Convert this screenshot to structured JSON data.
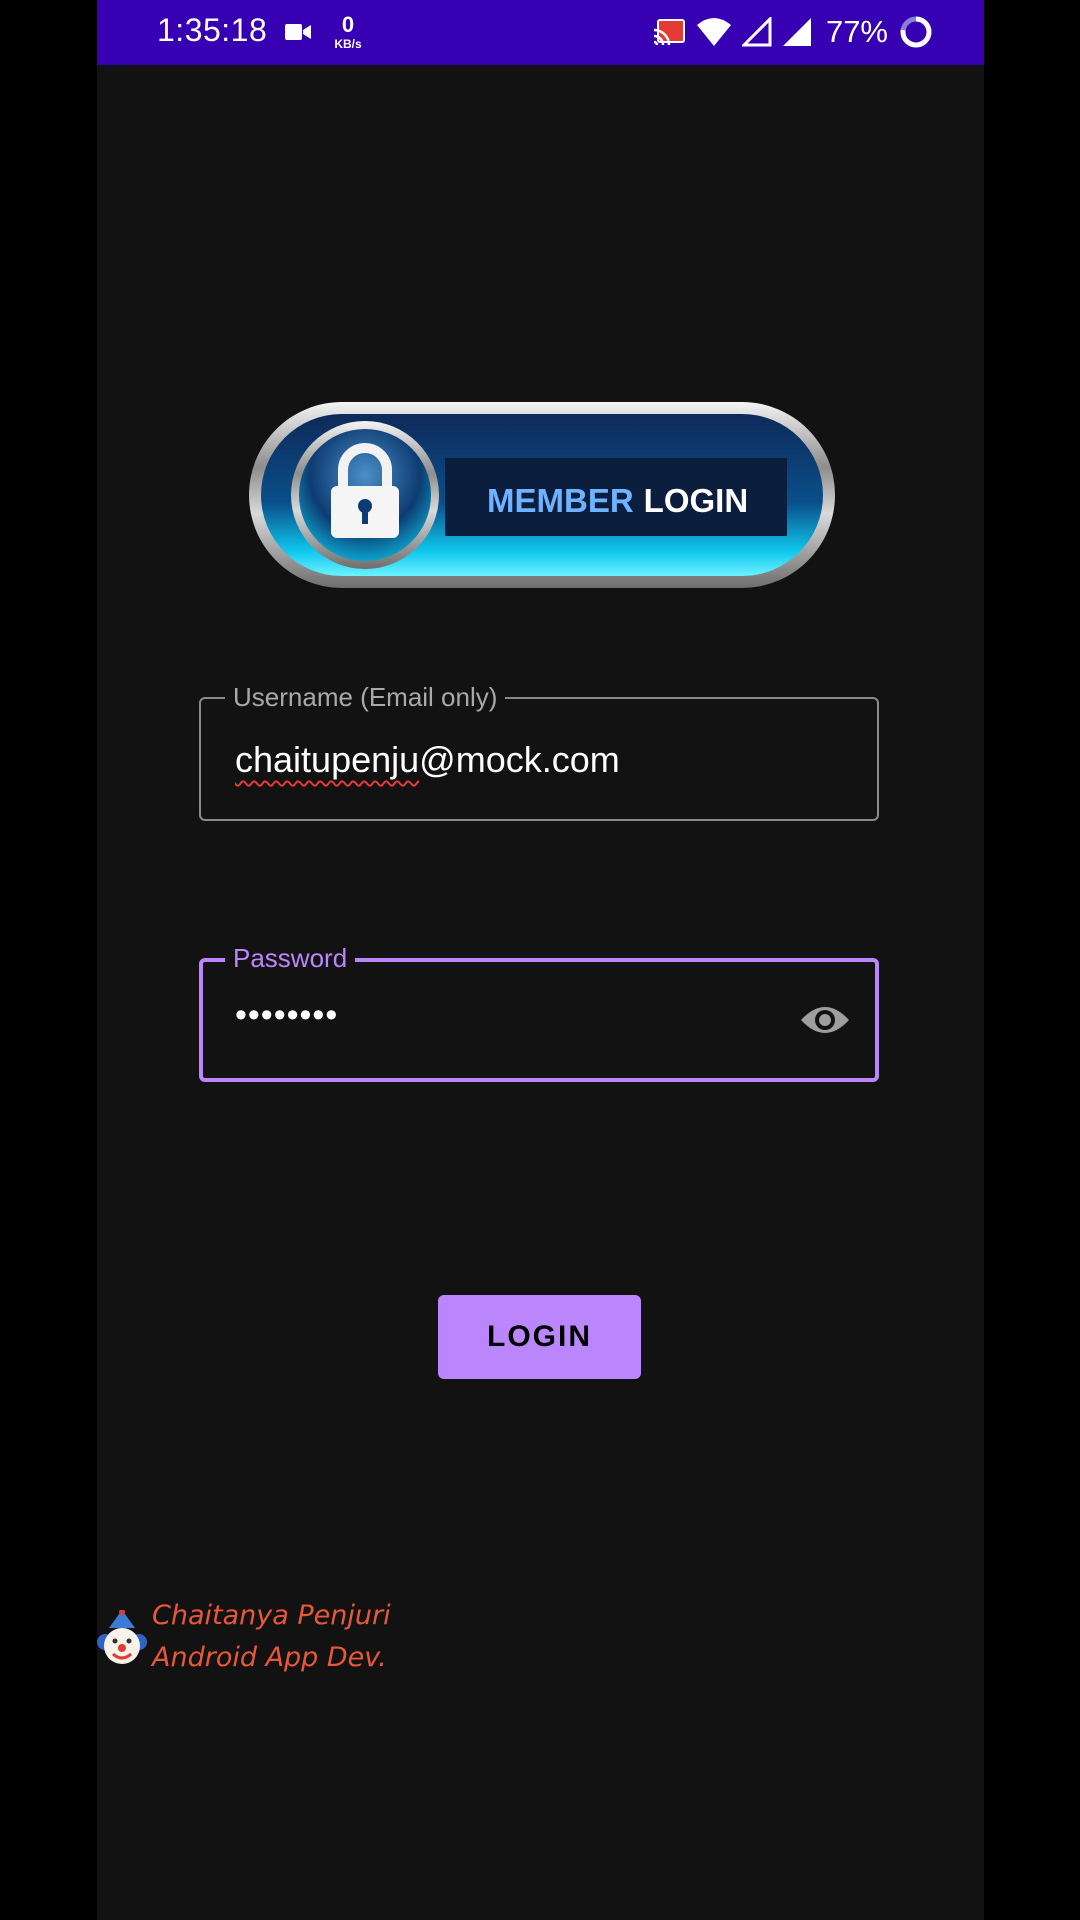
{
  "status_bar": {
    "time": "1:35:18",
    "net_speed_value": "0",
    "net_speed_unit": "KB/s",
    "battery": "77%",
    "icons": [
      "video-camera-icon",
      "cast-icon",
      "wifi-icon",
      "signal-empty-icon",
      "signal-full-icon",
      "battery-ring-icon"
    ],
    "background": "#3700b3"
  },
  "logo": {
    "text_member": "MEMBER",
    "text_login": "LOGIN",
    "icon": "padlock-icon"
  },
  "username_field": {
    "label": "Username (Email only)",
    "value_part1": "chaitupenju",
    "value_part2": "@mock.com"
  },
  "password_field": {
    "label": "Password",
    "value": "••••••••",
    "toggle_icon": "eye-icon",
    "accent": "#bb86fc"
  },
  "login_button": {
    "label": "LOGIN",
    "color": "#bb86fc"
  },
  "credit": {
    "icon": "clown-icon",
    "line1": "Chaitanya Penjuri",
    "line2": "Android App Dev.",
    "color": "#e8573a"
  },
  "theme": {
    "background": "#121212"
  }
}
